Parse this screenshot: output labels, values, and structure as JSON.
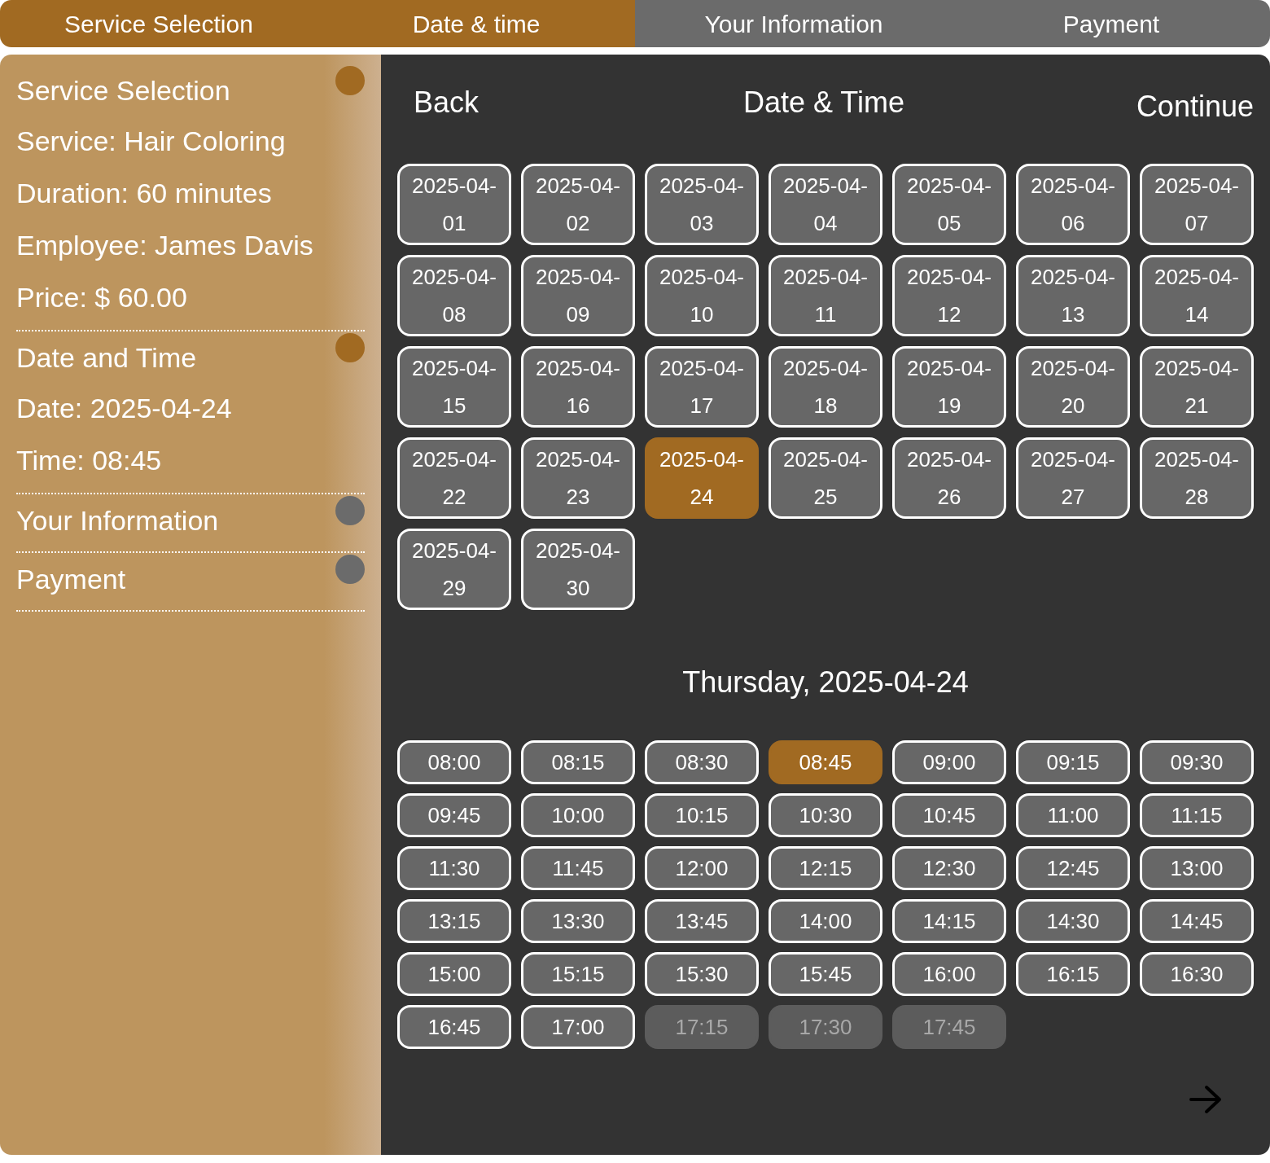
{
  "steps": [
    {
      "label": "Service Selection",
      "active": true
    },
    {
      "label": "Date & time",
      "active": true
    },
    {
      "label": "Your Information",
      "active": false
    },
    {
      "label": "Payment",
      "active": false
    }
  ],
  "summary": [
    {
      "title": "Service Selection",
      "done": true,
      "lines": [
        "Service: Hair Coloring",
        "Duration: 60 minutes",
        "Employee: James Davis",
        "Price: $ 60.00"
      ]
    },
    {
      "title": "Date and Time",
      "done": true,
      "lines": [
        "Date: 2025-04-24",
        "Time: 08:45"
      ]
    },
    {
      "title": "Your Information",
      "done": false
    },
    {
      "title": "Payment",
      "done": false
    }
  ],
  "header": {
    "back": "Back",
    "title": "Date & Time",
    "continue": "Continue"
  },
  "dates": [
    {
      "label": "2025-04-01",
      "selected": false
    },
    {
      "label": "2025-04-02",
      "selected": false
    },
    {
      "label": "2025-04-03",
      "selected": false
    },
    {
      "label": "2025-04-04",
      "selected": false
    },
    {
      "label": "2025-04-05",
      "selected": false
    },
    {
      "label": "2025-04-06",
      "selected": false
    },
    {
      "label": "2025-04-07",
      "selected": false
    },
    {
      "label": "2025-04-08",
      "selected": false
    },
    {
      "label": "2025-04-09",
      "selected": false
    },
    {
      "label": "2025-04-10",
      "selected": false
    },
    {
      "label": "2025-04-11",
      "selected": false
    },
    {
      "label": "2025-04-12",
      "selected": false
    },
    {
      "label": "2025-04-13",
      "selected": false
    },
    {
      "label": "2025-04-14",
      "selected": false
    },
    {
      "label": "2025-04-15",
      "selected": false
    },
    {
      "label": "2025-04-16",
      "selected": false
    },
    {
      "label": "2025-04-17",
      "selected": false
    },
    {
      "label": "2025-04-18",
      "selected": false
    },
    {
      "label": "2025-04-19",
      "selected": false
    },
    {
      "label": "2025-04-20",
      "selected": false
    },
    {
      "label": "2025-04-21",
      "selected": false
    },
    {
      "label": "2025-04-22",
      "selected": false
    },
    {
      "label": "2025-04-23",
      "selected": false
    },
    {
      "label": "2025-04-24",
      "selected": true
    },
    {
      "label": "2025-04-25",
      "selected": false
    },
    {
      "label": "2025-04-26",
      "selected": false
    },
    {
      "label": "2025-04-27",
      "selected": false
    },
    {
      "label": "2025-04-28",
      "selected": false
    },
    {
      "label": "2025-04-29",
      "selected": false
    },
    {
      "label": "2025-04-30",
      "selected": false
    }
  ],
  "day_heading": "Thursday, 2025-04-24",
  "slots": [
    {
      "label": "08:00",
      "selected": false,
      "disabled": false
    },
    {
      "label": "08:15",
      "selected": false,
      "disabled": false
    },
    {
      "label": "08:30",
      "selected": false,
      "disabled": false
    },
    {
      "label": "08:45",
      "selected": true,
      "disabled": false
    },
    {
      "label": "09:00",
      "selected": false,
      "disabled": false
    },
    {
      "label": "09:15",
      "selected": false,
      "disabled": false
    },
    {
      "label": "09:30",
      "selected": false,
      "disabled": false
    },
    {
      "label": "09:45",
      "selected": false,
      "disabled": false
    },
    {
      "label": "10:00",
      "selected": false,
      "disabled": false
    },
    {
      "label": "10:15",
      "selected": false,
      "disabled": false
    },
    {
      "label": "10:30",
      "selected": false,
      "disabled": false
    },
    {
      "label": "10:45",
      "selected": false,
      "disabled": false
    },
    {
      "label": "11:00",
      "selected": false,
      "disabled": false
    },
    {
      "label": "11:15",
      "selected": false,
      "disabled": false
    },
    {
      "label": "11:30",
      "selected": false,
      "disabled": false
    },
    {
      "label": "11:45",
      "selected": false,
      "disabled": false
    },
    {
      "label": "12:00",
      "selected": false,
      "disabled": false
    },
    {
      "label": "12:15",
      "selected": false,
      "disabled": false
    },
    {
      "label": "12:30",
      "selected": false,
      "disabled": false
    },
    {
      "label": "12:45",
      "selected": false,
      "disabled": false
    },
    {
      "label": "13:00",
      "selected": false,
      "disabled": false
    },
    {
      "label": "13:15",
      "selected": false,
      "disabled": false
    },
    {
      "label": "13:30",
      "selected": false,
      "disabled": false
    },
    {
      "label": "13:45",
      "selected": false,
      "disabled": false
    },
    {
      "label": "14:00",
      "selected": false,
      "disabled": false
    },
    {
      "label": "14:15",
      "selected": false,
      "disabled": false
    },
    {
      "label": "14:30",
      "selected": false,
      "disabled": false
    },
    {
      "label": "14:45",
      "selected": false,
      "disabled": false
    },
    {
      "label": "15:00",
      "selected": false,
      "disabled": false
    },
    {
      "label": "15:15",
      "selected": false,
      "disabled": false
    },
    {
      "label": "15:30",
      "selected": false,
      "disabled": false
    },
    {
      "label": "15:45",
      "selected": false,
      "disabled": false
    },
    {
      "label": "16:00",
      "selected": false,
      "disabled": false
    },
    {
      "label": "16:15",
      "selected": false,
      "disabled": false
    },
    {
      "label": "16:30",
      "selected": false,
      "disabled": false
    },
    {
      "label": "16:45",
      "selected": false,
      "disabled": false
    },
    {
      "label": "17:00",
      "selected": false,
      "disabled": false
    },
    {
      "label": "17:15",
      "selected": false,
      "disabled": true
    },
    {
      "label": "17:30",
      "selected": false,
      "disabled": true
    },
    {
      "label": "17:45",
      "selected": false,
      "disabled": true
    }
  ]
}
